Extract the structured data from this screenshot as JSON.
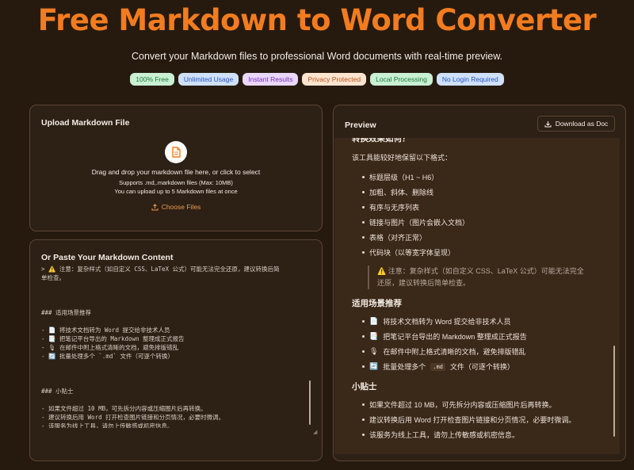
{
  "hero": {
    "title": "Free Markdown to Word Converter",
    "subtitle": "Convert your Markdown files to professional Word documents with real-time preview."
  },
  "badges": [
    {
      "label": "100% Free",
      "bg": "#c9f0d3",
      "fg": "#1f7a3b"
    },
    {
      "label": "Unlimited Usage",
      "bg": "#cfe0fb",
      "fg": "#2a56b8"
    },
    {
      "label": "Instant Results",
      "bg": "#ead7fb",
      "fg": "#7a33b8"
    },
    {
      "label": "Privacy Protected",
      "bg": "#fde4cf",
      "fg": "#b4561d"
    },
    {
      "label": "Local Processing",
      "bg": "#c9f0d3",
      "fg": "#1f7a3b"
    },
    {
      "label": "No Login Required",
      "bg": "#cfe0fb",
      "fg": "#2a56b8"
    }
  ],
  "upload": {
    "title": "Upload Markdown File",
    "drag_text": "Drag and drop your markdown file here, or click to select",
    "supports": "Supports .md,.markdown files (Max: 10MB)",
    "limit": "You can upload up to 5 Markdown files at once",
    "choose_label": "Choose Files"
  },
  "paste": {
    "title": "Or Paste Your Markdown Content",
    "lines": [
      "> ⚠️ 注意：复杂样式（如自定义 CSS、LaTeX 公式）可能无法完全还原，建议转换后简",
      "单检查。",
      "",
      "",
      "",
      "### 适用场景推荐",
      "",
      "- 📄 将技术文档转为 Word 提交给非技术人员",
      "- 📑 把笔记平台导出的 Markdown 整理成正式报告",
      "- 🎙 在邮件中附上格式清晰的文档，避免排版错乱",
      "- 🔄 批量处理多个 `.md` 文件（可逐个转换）",
      "",
      "",
      "",
      "### 小贴士",
      "",
      "- 如果文件超过 10 MB，可先拆分内容或压缩图片后再转换。",
      "- 建议转换后用 Word 打开检查图片链接和分页情况，必要时微调。",
      "- 该服务为线上工具，请勿上传敏感或机密信息。"
    ]
  },
  "preview": {
    "title": "Preview",
    "download_label": "Download as Doc",
    "heading1": "转换效果如何？",
    "intro": "该工具能较好地保留以下格式：",
    "formats": [
      "标题层级（H1 ~ H6）",
      "加粗、斜体、删除线",
      "有序与无序列表",
      "链接与图片（图片会嵌入文档）",
      "表格（对齐正常）",
      "代码块（以等宽字体呈现）"
    ],
    "note_line1": "⚠️ 注意：复杂样式（如自定义 CSS、LaTeX 公式）可能无法完全",
    "note_line2": "还原，建议转换后简单检查。",
    "heading2": "适用场景推荐",
    "scenarios": [
      {
        "icon": "📄",
        "text": "将技术文档转为 Word 提交给非技术人员"
      },
      {
        "icon": "📑",
        "text": "把笔记平台导出的 Markdown 整理成正式报告"
      },
      {
        "icon": "🎙",
        "text": "在邮件中附上格式清晰的文档，避免排版错乱"
      },
      {
        "icon": "🔄",
        "text_a": "批量处理多个",
        "code": ".md",
        "text_b": "文件（可逐个转换）"
      }
    ],
    "heading3": "小贴士",
    "tips": [
      "如果文件超过 10 MB，可先拆分内容或压缩图片后再转换。",
      "建议转换后用 Word 打开检查图片链接和分页情况，必要时微调。",
      "该服务为线上工具，请勿上传敏感或机密信息。"
    ]
  }
}
